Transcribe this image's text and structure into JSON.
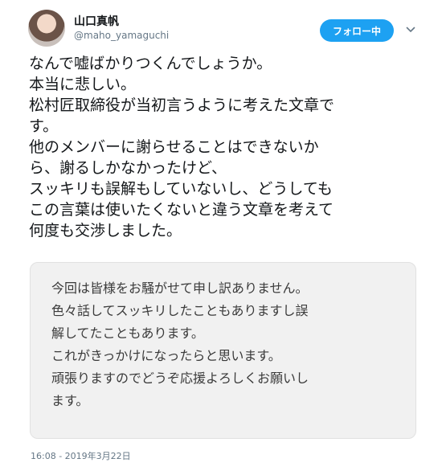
{
  "user": {
    "name": "山口真帆",
    "handle": "@maho_yamaguchi"
  },
  "follow_button": {
    "label": "フォロー中"
  },
  "tweet": {
    "lines": [
      "なんで嘘ばかりつくんでしょうか。",
      "本当に悲しい。",
      "松村匠取締役が当初言うように考えた文章で",
      "す。",
      "他のメンバーに謝らせることはできないか",
      "ら、謝るしかなかったけど、",
      "スッキリも誤解もしていないし、どうしても",
      "この言葉は使いたくないと違う文章を考えて",
      "何度も交渉しました。"
    ]
  },
  "quote_image": {
    "lines": [
      "今回は皆様をお騒がせて申し訳ありません。",
      "色々話してスッキリしたこともありますし誤",
      "解してたこともあります。",
      "これがきっかけになったらと思います。",
      "頑張りますのでどうぞ応援よろしくお願いし",
      "ます。"
    ]
  },
  "timestamp": "16:08 - 2019年3月22日",
  "colors": {
    "accent": "#1da1f2",
    "text": "#14171a",
    "muted": "#657786"
  },
  "icons": {
    "chevron": "chevron-down-icon"
  }
}
